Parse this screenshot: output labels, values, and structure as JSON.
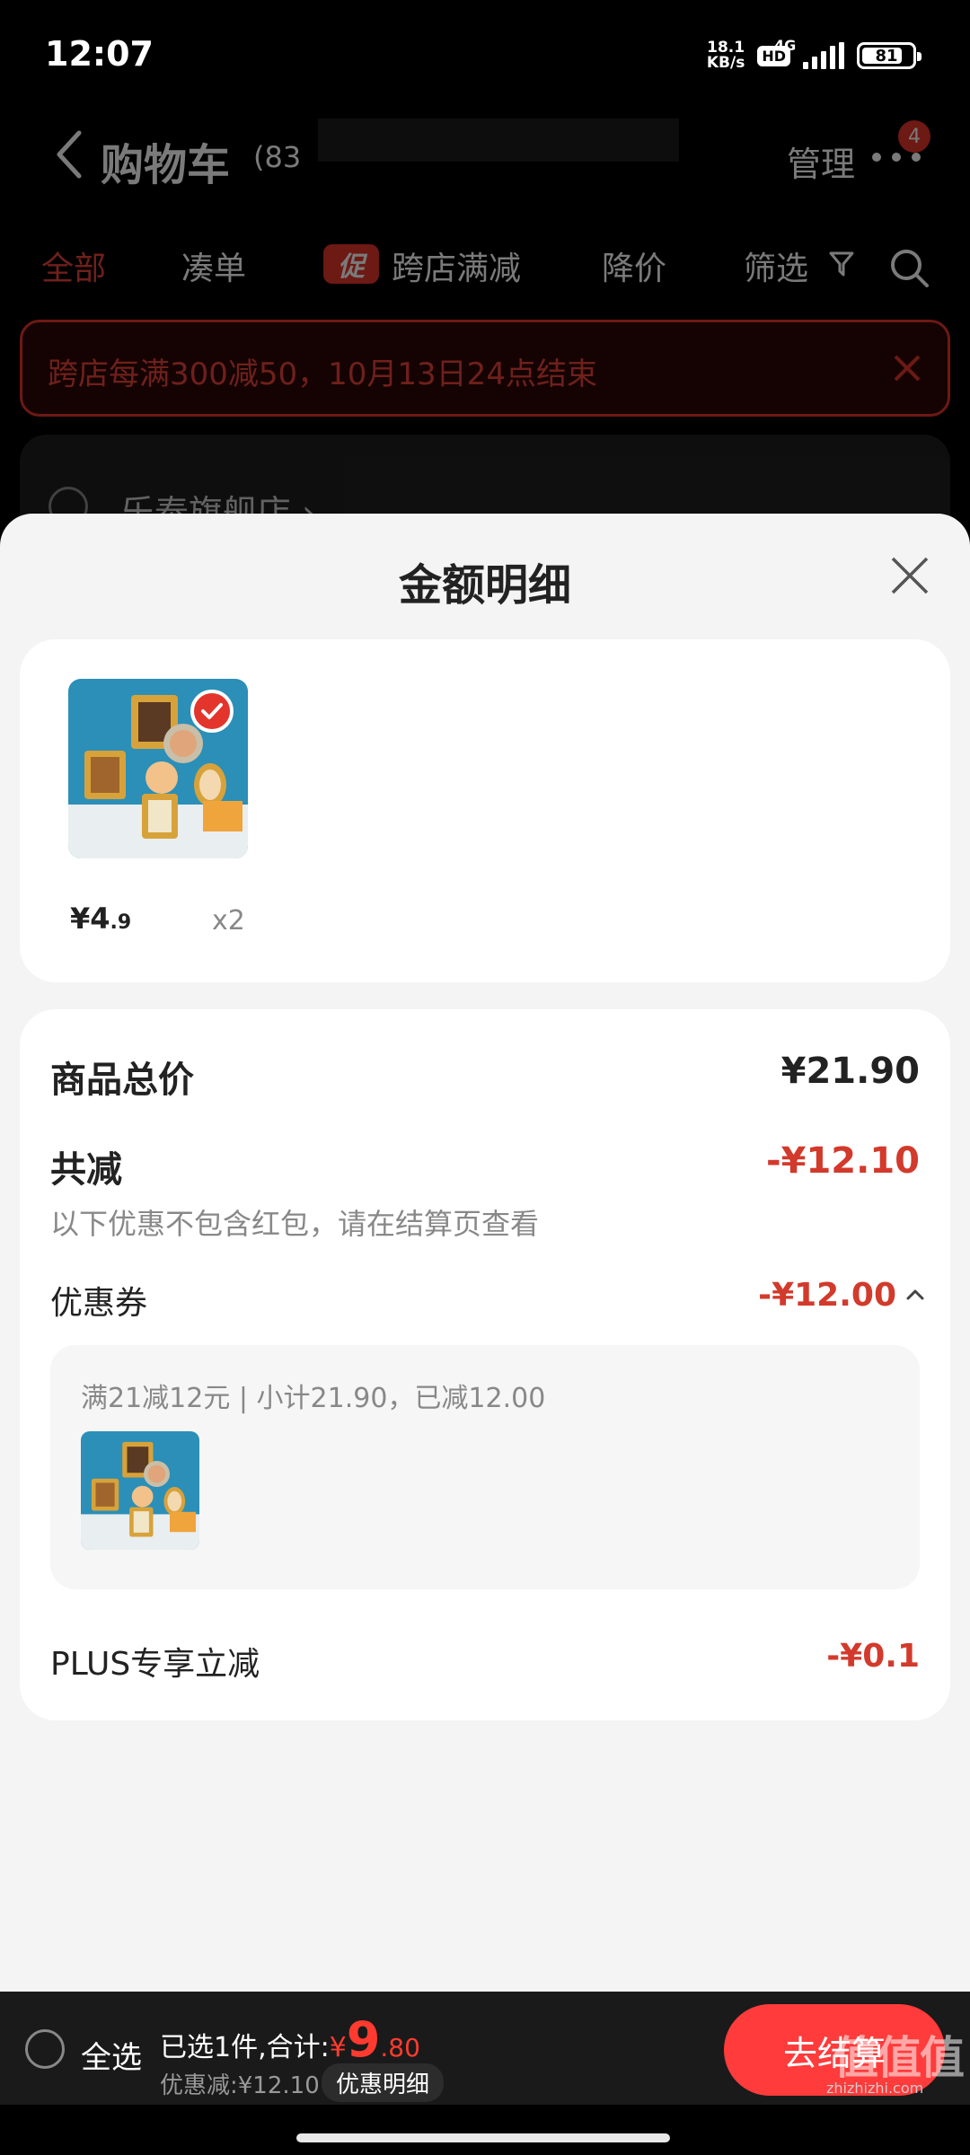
{
  "status_bar": {
    "time": "12:07",
    "net_speed_value": "18.1",
    "net_speed_unit": "KB/s",
    "hd": "HD",
    "network": "4G",
    "battery": "81",
    "battery_level": 0.81
  },
  "nav": {
    "title": "购物车",
    "count": "(83",
    "manage": "管理",
    "badge": "4"
  },
  "tabs": [
    {
      "label": "全部",
      "active": true
    },
    {
      "label": "凑单"
    },
    {
      "label": "跨店满减",
      "tag": "促"
    },
    {
      "label": "降价"
    },
    {
      "label": "筛选"
    }
  ],
  "promo_banner": {
    "text": "跨店每满300减50，10月13日24点结束"
  },
  "store": {
    "name": "乐泰旗舰店 ›"
  },
  "sheet": {
    "title": "金额明细",
    "item": {
      "price_symbol": "¥",
      "price_int": "4",
      "price_dec": ".9",
      "qty": "x2"
    },
    "total_label": "商品总价",
    "total_value": "¥21.90",
    "discount_label": "共减",
    "discount_value": "-¥12.10",
    "discount_note": "以下优惠不包含红包，请在结算页查看",
    "coupon_label": "优惠券",
    "coupon_value": "-¥12.00",
    "coupon_rule": "满21减12元 | 小计21.90，已减12.00",
    "plus_label": "PLUS专享立减",
    "plus_value": "-¥0.1"
  },
  "checkout": {
    "select_all": "全选",
    "selected_text": "已选1件,合计:",
    "currency": "¥",
    "total_int": "9",
    "total_dec": ".80",
    "discount_text": "优惠减:¥12.10",
    "detail_button": "优惠明细",
    "checkout_button": "去结算",
    "watermark": "值值值",
    "watermark_url": "zhizhizhi.com"
  },
  "colors": {
    "accent": "#e3352b",
    "checkout_button": "#ff3b3b",
    "sheet_bg": "#f4f4f4"
  },
  "icons": [
    "back-icon",
    "more-icon",
    "filter-icon",
    "search-icon",
    "close-icon",
    "check-icon",
    "chevron-up-icon"
  ]
}
